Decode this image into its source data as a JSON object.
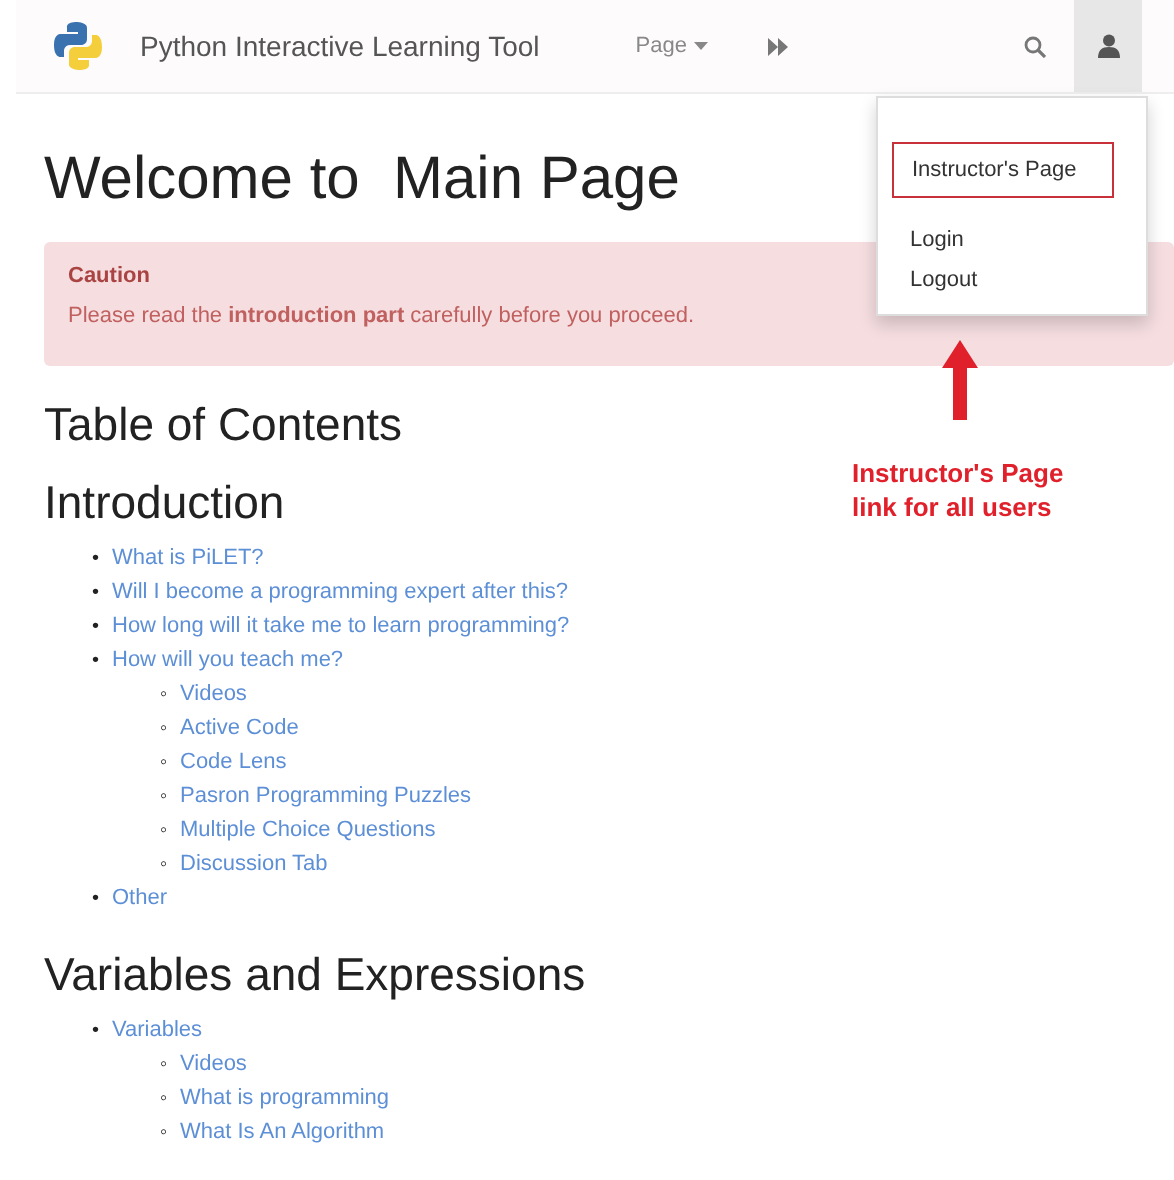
{
  "navbar": {
    "brand": "Python Interactive Learning Tool",
    "menu": "Page",
    "user_menu_open": true
  },
  "dropdown": {
    "items": [
      {
        "label": "Instructor's Page",
        "annotated": true
      },
      {
        "label": "Login",
        "annotated": false
      },
      {
        "label": "Logout",
        "annotated": false
      }
    ]
  },
  "annotation": {
    "lines": [
      "Instructor's Page",
      "link for all users"
    ]
  },
  "title": "Welcome to  Main Page",
  "alert": {
    "title": "Caution",
    "message": "Please read the **introduction part** carefully before you proceed."
  },
  "toc_heading": "Table of Contents",
  "sections": [
    {
      "heading": "Introduction",
      "items": [
        {
          "marker": "•",
          "label": "What is PiLET?"
        },
        {
          "marker": "•",
          "label": "Will I become a programming expert after this?"
        },
        {
          "marker": "•",
          "label": "How long will it take me to learn programming?"
        },
        {
          "marker": "•",
          "label": "How will you teach me?",
          "children": [
            {
              "marker": "◦",
              "label": "Videos"
            },
            {
              "marker": "◦",
              "label": "Active Code"
            },
            {
              "marker": "◦",
              "label": "Code Lens"
            },
            {
              "marker": "◦",
              "label": "Pasron Programming Puzzles"
            },
            {
              "marker": "◦",
              "label": "Multiple Choice Questions"
            },
            {
              "marker": "◦",
              "label": "Discussion Tab"
            }
          ]
        },
        {
          "marker": "•",
          "label": "Other"
        }
      ]
    },
    {
      "heading": "Variables and Expressions",
      "items": [
        {
          "marker": "•",
          "label": "Variables",
          "children": [
            {
              "marker": "◦",
              "label": "Videos"
            },
            {
              "marker": "◦",
              "label": "What is programming"
            },
            {
              "marker": "◦",
              "label": "What Is An Algorithm"
            }
          ]
        }
      ]
    }
  ]
}
